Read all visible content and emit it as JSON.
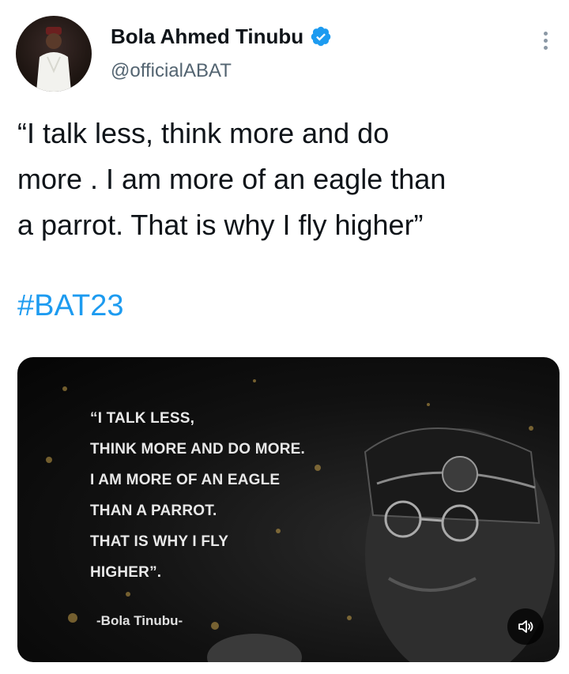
{
  "author": {
    "name": "Bola Ahmed Tinubu",
    "handle": "@officialABAT",
    "verified": true
  },
  "tweet": {
    "text": "“I talk less, think more and do\nmore . I am more of an eagle than\na parrot. That is why I fly higher”",
    "hashtag": "#BAT23"
  },
  "media": {
    "quote": "“I TALK LESS,\nTHINK MORE AND DO MORE.\nI AM MORE OF AN EAGLE\nTHAN A PARROT.\nTHAT IS WHY I FLY\nHIGHER”.",
    "attribution": "-Bola Tinubu-",
    "sound_icon": "speaker-icon"
  },
  "colors": {
    "accent": "#1d9bf0",
    "text": "#0f1419",
    "secondary": "#536471"
  }
}
